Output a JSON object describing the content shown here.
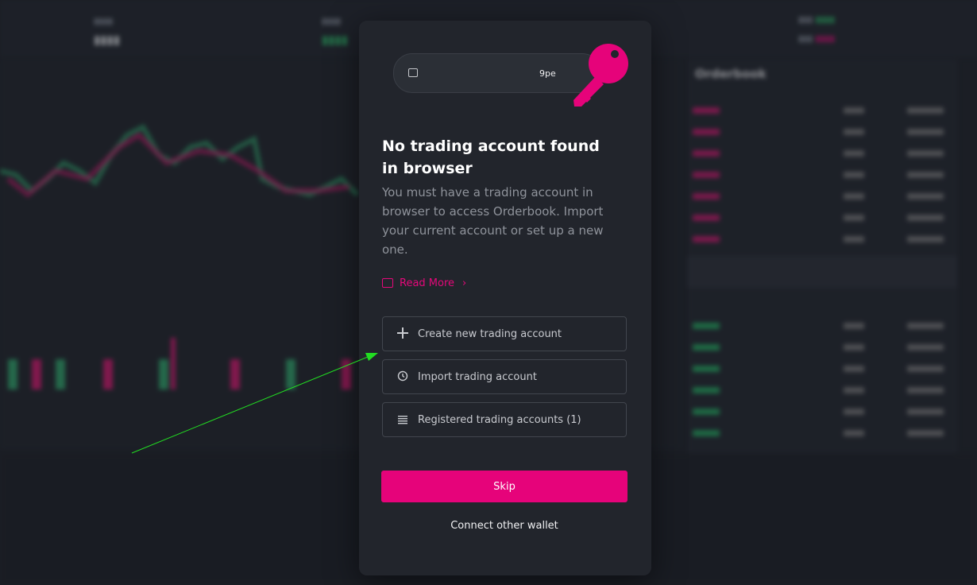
{
  "modal": {
    "pill_text": "9pe",
    "title": "No trading account found in browser",
    "description": "You must have a trading account in browser to access Orderbook. Import your current account or set up a new one.",
    "read_more": "Read More",
    "options": [
      {
        "label": "Create new trading account",
        "icon": "plus-icon"
      },
      {
        "label": "Import trading account",
        "icon": "history-icon"
      },
      {
        "label": "Registered trading accounts (1)",
        "icon": "list-icon"
      }
    ],
    "skip_label": "Skip",
    "connect_label": "Connect other wallet"
  },
  "background": {
    "orderbook_title": "Orderbook"
  },
  "colors": {
    "accent": "#e6037a",
    "annotation_arrow": "#22dd22",
    "modal_bg": "#22252c"
  }
}
